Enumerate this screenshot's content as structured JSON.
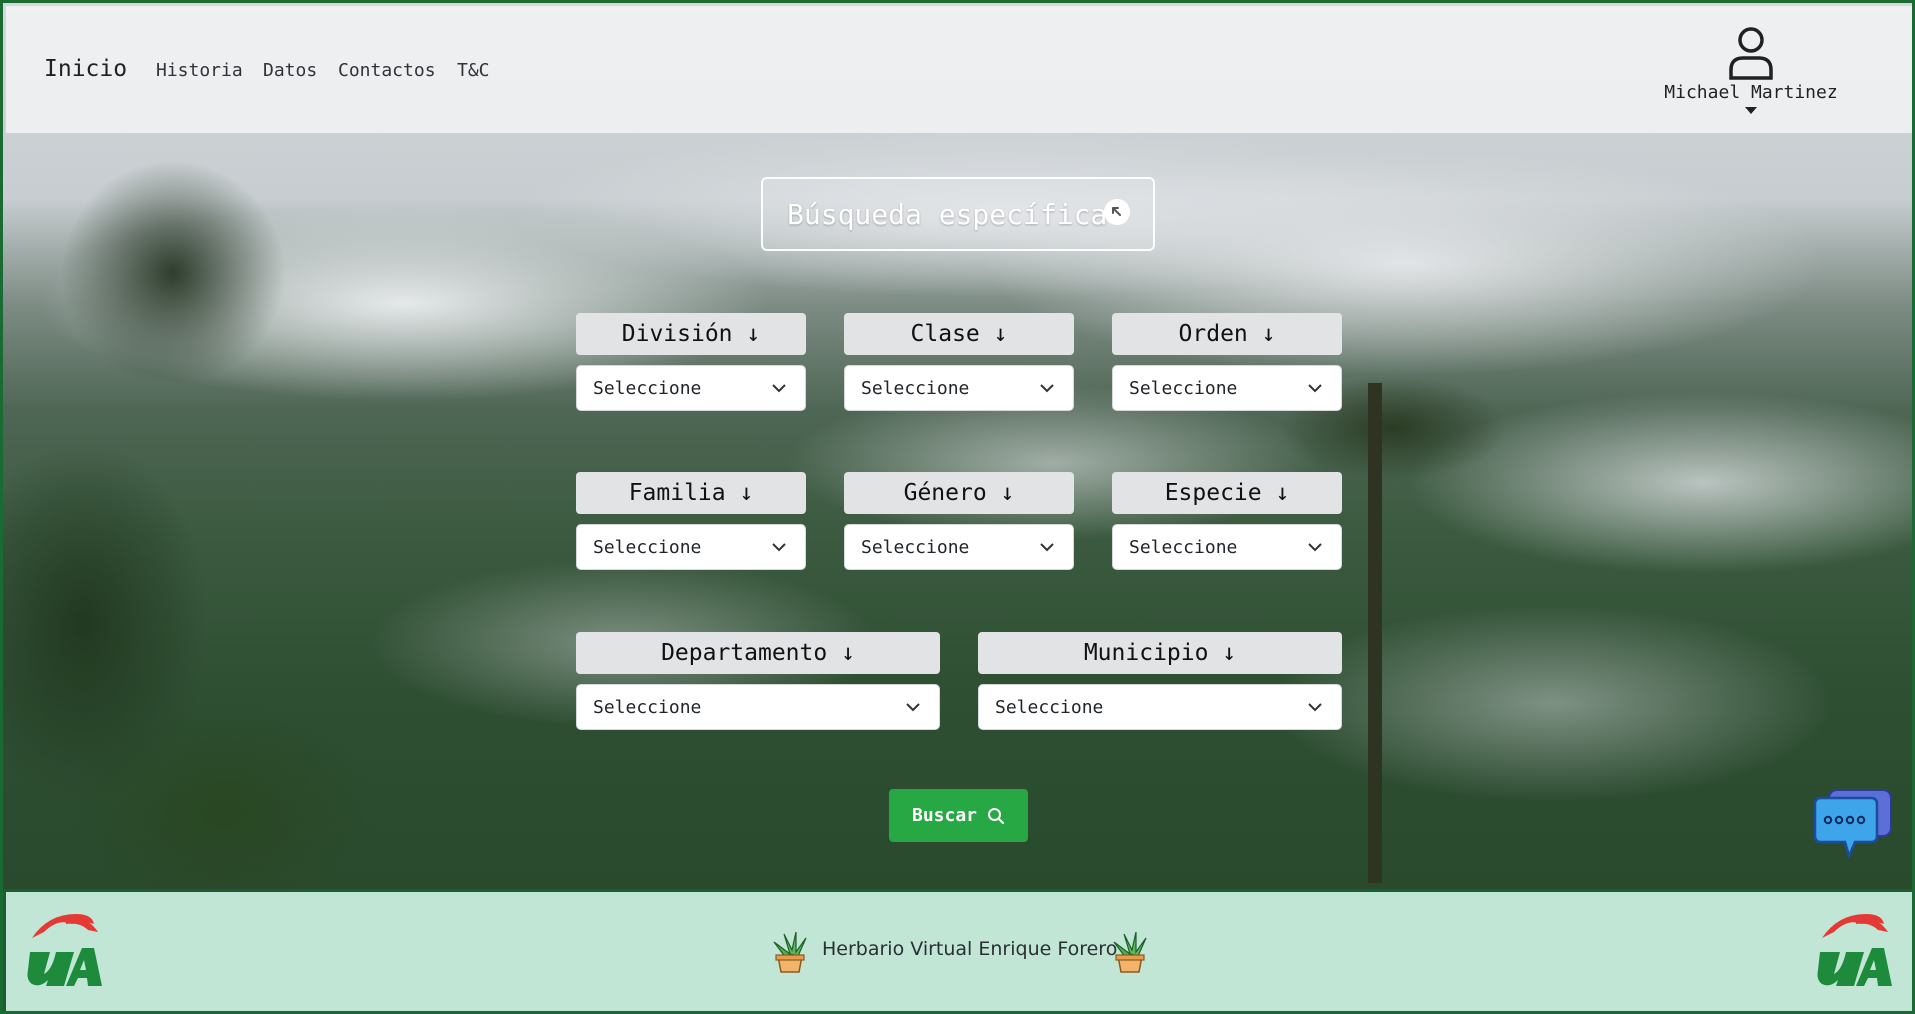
{
  "nav": {
    "brand": "Inicio",
    "links": [
      "Historia",
      "Datos",
      "Contactos",
      "T&C"
    ]
  },
  "user": {
    "name": "Michael Martinez"
  },
  "search": {
    "title": "Búsqueda específica"
  },
  "filters": [
    {
      "label": "División ↓",
      "value": "Seleccione"
    },
    {
      "label": "Clase ↓",
      "value": "Seleccione"
    },
    {
      "label": "Orden ↓",
      "value": "Seleccione"
    },
    {
      "label": "Familia ↓",
      "value": "Seleccione"
    },
    {
      "label": "Género ↓",
      "value": "Seleccione"
    },
    {
      "label": "Especie ↓",
      "value": "Seleccione"
    },
    {
      "label": "Departamento ↓",
      "value": "Seleccione"
    },
    {
      "label": "Municipio ↓",
      "value": "Seleccione"
    }
  ],
  "button": {
    "label": "Buscar"
  },
  "footer": {
    "text": "Herbario Virtual Enrique Forero"
  },
  "colors": {
    "primary_button": "#28a745",
    "footer_bg": "#c1e6d6",
    "frame": "#1a6b33",
    "logo_green": "#1e8a3c",
    "logo_red": "#e53935"
  }
}
